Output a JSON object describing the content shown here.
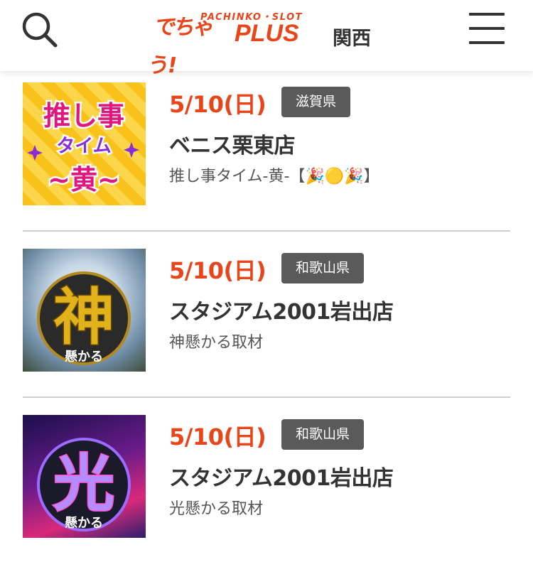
{
  "header": {
    "logo": {
      "sub": "PACHINKO・SLOT",
      "mark": "でちゃう!",
      "plus": "PLUS",
      "region": "関西"
    }
  },
  "items": [
    {
      "date": "5/10(日)",
      "prefecture": "滋賀県",
      "shop": "ベニス栗東店",
      "event": "推し事タイム-黄-【🎉🟡🎉】",
      "thumb_text": [
        "推し事",
        "タイム",
        "~黄~"
      ]
    },
    {
      "date": "5/10(日)",
      "prefecture": "和歌山県",
      "shop": "スタジアム2001岩出店",
      "event": "神懸かる取材",
      "thumb_text": [
        "神",
        "懸かる"
      ]
    },
    {
      "date": "5/10(日)",
      "prefecture": "和歌山県",
      "shop": "スタジアム2001岩出店",
      "event": "光懸かる取材",
      "thumb_text": [
        "光",
        "懸かる"
      ]
    }
  ]
}
